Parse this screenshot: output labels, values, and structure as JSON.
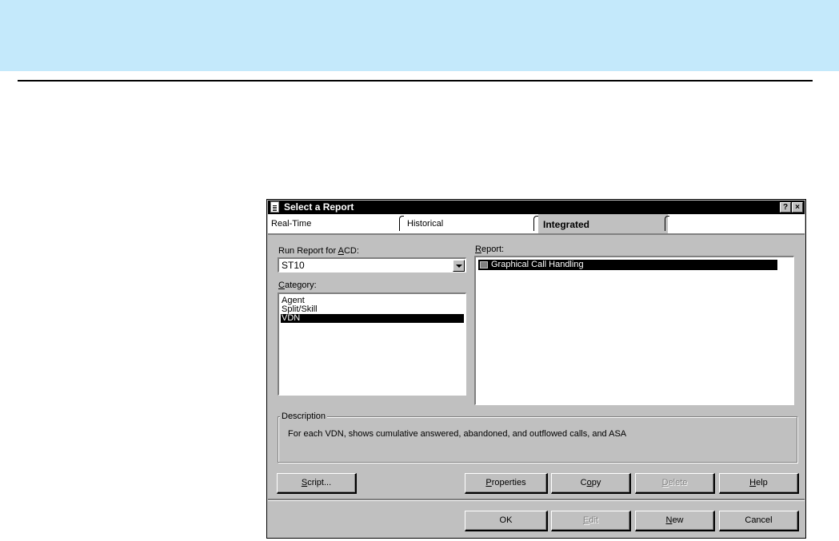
{
  "window": {
    "title": "Select a Report",
    "help_btn": "?",
    "close_btn": "×"
  },
  "tabs": [
    {
      "label": "Real-Time",
      "active": false
    },
    {
      "label": "Historical",
      "active": false
    },
    {
      "label": "Integrated",
      "active": true
    }
  ],
  "acd": {
    "label_pre": "Run Report for ",
    "label_key": "A",
    "label_post": "CD:",
    "value": "ST10"
  },
  "category": {
    "label_key": "C",
    "label_post": "ategory:",
    "items": [
      "Agent",
      "Split/Skill",
      "VDN"
    ],
    "selected": "VDN"
  },
  "report": {
    "label_key": "R",
    "label_post": "eport:",
    "items": [
      "Graphical Call Handling"
    ]
  },
  "description": {
    "title": "Description",
    "text": "For each VDN, shows cumulative answered, abandoned, and outflowed calls, and ASA"
  },
  "buttons_row1": {
    "script": {
      "key": "S",
      "rest": "cript...",
      "enabled": true
    },
    "properties": {
      "key": "P",
      "rest": "roperties",
      "enabled": true
    },
    "copy": {
      "pre": "C",
      "key": "o",
      "rest": "py",
      "enabled": true
    },
    "delete": {
      "key": "D",
      "rest": "elete",
      "enabled": false
    },
    "help": {
      "key": "H",
      "rest": "elp",
      "enabled": true
    }
  },
  "buttons_row2": {
    "ok": {
      "label": "OK",
      "enabled": true
    },
    "edit": {
      "key": "E",
      "rest": "dit",
      "enabled": false
    },
    "new": {
      "key": "N",
      "rest": "ew",
      "enabled": true
    },
    "cancel": {
      "label": "Cancel",
      "enabled": true
    }
  },
  "colors": {
    "header_band": "#c4e9fb",
    "dialog_face": "#c0c0c0",
    "titlebar": "#000000",
    "selection": "#000000"
  }
}
